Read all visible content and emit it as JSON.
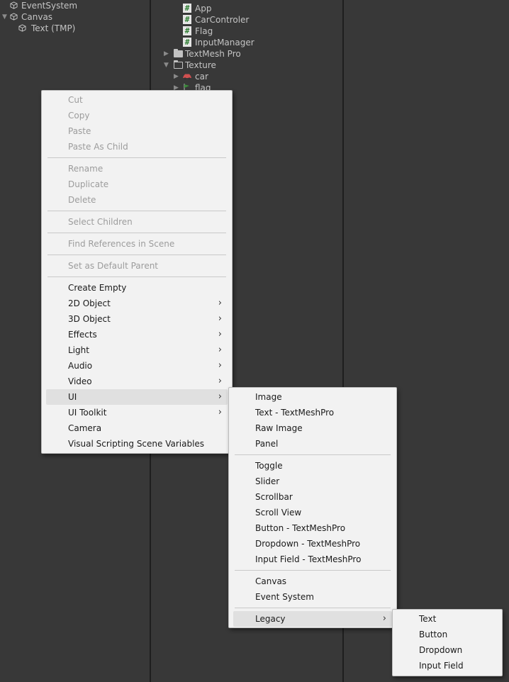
{
  "hierarchy": {
    "items": [
      {
        "label": "EventSystem"
      },
      {
        "label": "Canvas"
      },
      {
        "label": "Text (TMP)"
      }
    ]
  },
  "project": {
    "items": [
      {
        "label": "App"
      },
      {
        "label": "CarControler"
      },
      {
        "label": "Flag"
      },
      {
        "label": "InputManager"
      },
      {
        "label": "TextMesh Pro"
      },
      {
        "label": "Texture"
      },
      {
        "label": "car"
      },
      {
        "label": "flag"
      }
    ]
  },
  "context_menu": {
    "items": [
      {
        "label": "Cut"
      },
      {
        "label": "Copy"
      },
      {
        "label": "Paste"
      },
      {
        "label": "Paste As Child"
      },
      {
        "label": "Rename"
      },
      {
        "label": "Duplicate"
      },
      {
        "label": "Delete"
      },
      {
        "label": "Select Children"
      },
      {
        "label": "Find References in Scene"
      },
      {
        "label": "Set as Default Parent"
      },
      {
        "label": "Create Empty"
      },
      {
        "label": "2D Object"
      },
      {
        "label": "3D Object"
      },
      {
        "label": "Effects"
      },
      {
        "label": "Light"
      },
      {
        "label": "Audio"
      },
      {
        "label": "Video"
      },
      {
        "label": "UI"
      },
      {
        "label": "UI Toolkit"
      },
      {
        "label": "Camera"
      },
      {
        "label": "Visual Scripting Scene Variables"
      }
    ]
  },
  "ui_submenu": {
    "items": [
      {
        "label": "Image"
      },
      {
        "label": "Text - TextMeshPro"
      },
      {
        "label": "Raw Image"
      },
      {
        "label": "Panel"
      },
      {
        "label": "Toggle"
      },
      {
        "label": "Slider"
      },
      {
        "label": "Scrollbar"
      },
      {
        "label": "Scroll View"
      },
      {
        "label": "Button - TextMeshPro"
      },
      {
        "label": "Dropdown - TextMeshPro"
      },
      {
        "label": "Input Field - TextMeshPro"
      },
      {
        "label": "Canvas"
      },
      {
        "label": "Event System"
      },
      {
        "label": "Legacy"
      }
    ]
  },
  "legacy_submenu": {
    "items": [
      {
        "label": "Text"
      },
      {
        "label": "Button"
      },
      {
        "label": "Dropdown"
      },
      {
        "label": "Input Field"
      }
    ]
  },
  "submenu_arrow": "›",
  "icons": {
    "gameobject": "cube-icon",
    "script": "csharp-script-icon",
    "folder": "folder-icon",
    "open_folder": "folder-open-icon",
    "car_texture": "car-icon",
    "flag_texture": "flag-icon"
  }
}
